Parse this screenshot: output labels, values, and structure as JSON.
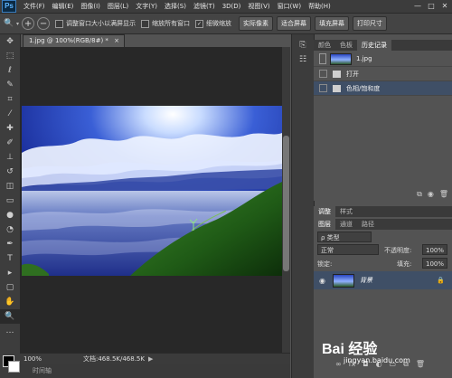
{
  "app": {
    "logo": "Ps"
  },
  "menu": [
    "文件(F)",
    "编辑(E)",
    "图像(I)",
    "图层(L)",
    "文字(Y)",
    "选择(S)",
    "滤镜(T)",
    "3D(D)",
    "视图(V)",
    "窗口(W)",
    "帮助(H)"
  ],
  "options": {
    "resize_windows": "调整窗口大小以满屏显示",
    "zoom_all": "缩放所有窗口",
    "scrubby_zoom": "细微缩放",
    "actual_pixels": "实际像素",
    "fit_screen": "适合屏幕",
    "fill_screen": "填充屏幕",
    "print_size": "打印尺寸"
  },
  "document": {
    "tab_title": "1.jpg @ 100%(RGB/8#) *",
    "close": "×"
  },
  "status": {
    "zoom": "100%",
    "doc_size": "文档:468.5K/468.5K"
  },
  "timeline": {
    "label": "时间轴"
  },
  "history": {
    "tabs": [
      "颜色",
      "色板",
      "历史记录"
    ],
    "active_tab": 2,
    "snapshot": "1.jpg",
    "items": [
      "打开",
      "色相/饱和度"
    ]
  },
  "adjustments": {
    "tabs": [
      "调整",
      "样式"
    ]
  },
  "layers": {
    "tabs": [
      "图层",
      "通道",
      "路径"
    ],
    "filter_kind": "ρ 类型",
    "blend_mode": "正常",
    "opacity_label": "不透明度:",
    "opacity_value": "100%",
    "lock_label": "锁定:",
    "fill_label": "填充:",
    "fill_value": "100%",
    "layer_name": "背景"
  },
  "watermark": {
    "text": "Bai 经验",
    "url": "jingyan.baidu.com"
  },
  "colors": {
    "fg": "#000000",
    "bg": "#ffffff",
    "accent": "#3f4f66"
  }
}
